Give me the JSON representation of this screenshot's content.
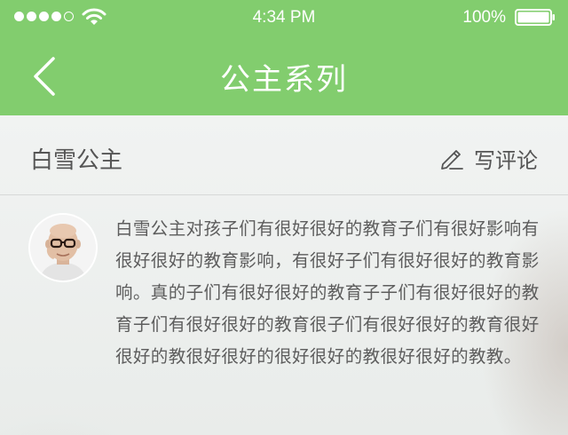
{
  "status_bar": {
    "time": "4:34 PM",
    "battery_percent": "100%",
    "signal_bars_filled": 4,
    "signal_bars_total": 5,
    "icons": [
      "signal-icon",
      "wifi-icon",
      "battery-icon"
    ]
  },
  "nav": {
    "title": "公主系列",
    "back_icon": "chevron-left-icon"
  },
  "section": {
    "title": "白雪公主",
    "write_comment_label": "写评论",
    "write_icon": "pencil-icon"
  },
  "comment": {
    "avatar": "avatar",
    "text": "白雪公主对孩子们有很好很好的教育子们有很好影响有很好很好的教育影响，有很好子们有很好很好的教育影响。真的子们有很好很好的教育子子们有很好很好的教育子们有很好很好的教育很子们有很好很好的教育很好很好的教很好很好的很好很好的教很好很好的教教。"
  },
  "colors": {
    "header_green": "#82cd6e",
    "text_dark": "#555555",
    "background": "#eef0ef"
  }
}
